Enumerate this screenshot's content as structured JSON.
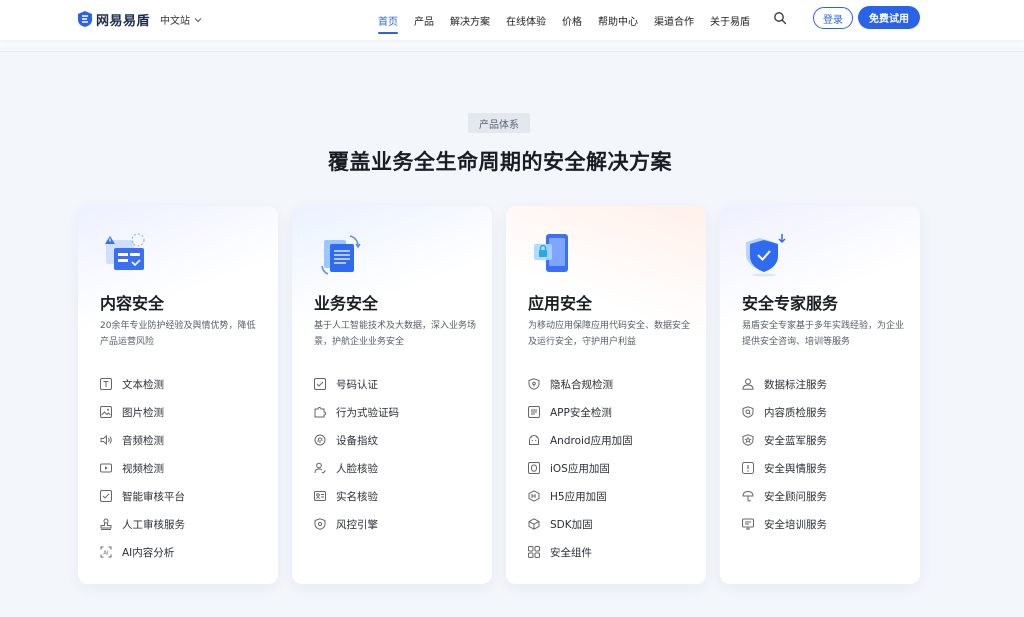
{
  "header": {
    "logo_text": "网易易盾",
    "lang_label": "中文站",
    "nav": [
      "首页",
      "产品",
      "解决方案",
      "在线体验",
      "价格",
      "帮助中心",
      "渠道合作",
      "关于易盾"
    ],
    "active_nav_index": 0,
    "login_label": "登录",
    "trial_label": "免费试用",
    "accent_color": "#2a63e8"
  },
  "section": {
    "tag": "产品体系",
    "title": "覆盖业务全生命周期的安全解决方案"
  },
  "cards": [
    {
      "title": "内容安全",
      "desc": "20余年专业防护经验及舆情优势，降低产品运营风险",
      "icon": "content-security-illustration",
      "items": [
        {
          "label": "文本检测",
          "icon": "text-icon"
        },
        {
          "label": "图片检测",
          "icon": "image-icon"
        },
        {
          "label": "音频检测",
          "icon": "audio-icon"
        },
        {
          "label": "视频检测",
          "icon": "video-icon"
        },
        {
          "label": "智能审核平台",
          "icon": "review-platform-icon"
        },
        {
          "label": "人工审核服务",
          "icon": "manual-review-icon"
        },
        {
          "label": "AI内容分析",
          "icon": "ai-analysis-icon"
        }
      ]
    },
    {
      "title": "业务安全",
      "desc": "基于人工智能技术及大数据，深入业务场景，护航企业业务安全",
      "icon": "business-security-illustration",
      "items": [
        {
          "label": "号码认证",
          "icon": "phone-verify-icon"
        },
        {
          "label": "行为式验证码",
          "icon": "puzzle-icon"
        },
        {
          "label": "设备指纹",
          "icon": "fingerprint-icon"
        },
        {
          "label": "人脸核验",
          "icon": "face-verify-icon"
        },
        {
          "label": "实名核验",
          "icon": "id-card-icon"
        },
        {
          "label": "风控引擎",
          "icon": "shield-engine-icon"
        }
      ]
    },
    {
      "title": "应用安全",
      "desc": "为移动应用保障应用代码安全、数据安全及运行安全，守护用户利益",
      "icon": "app-security-illustration",
      "items": [
        {
          "label": "隐私合规检测",
          "icon": "privacy-icon"
        },
        {
          "label": "APP安全检测",
          "icon": "app-check-icon"
        },
        {
          "label": "Android应用加固",
          "icon": "android-icon"
        },
        {
          "label": "iOS应用加固",
          "icon": "ios-icon"
        },
        {
          "label": "H5应用加固",
          "icon": "h5-icon"
        },
        {
          "label": "SDK加固",
          "icon": "sdk-icon"
        },
        {
          "label": "安全组件",
          "icon": "components-icon"
        }
      ]
    },
    {
      "title": "安全专家服务",
      "desc": "易盾安全专家基于多年实践经验，为企业提供安全咨询、培训等服务",
      "icon": "expert-service-illustration",
      "items": [
        {
          "label": "数据标注服务",
          "icon": "user-icon"
        },
        {
          "label": "内容质检服务",
          "icon": "quality-check-icon"
        },
        {
          "label": "安全蓝军服务",
          "icon": "blue-team-icon"
        },
        {
          "label": "安全舆情服务",
          "icon": "alert-icon"
        },
        {
          "label": "安全顾问服务",
          "icon": "advisor-icon"
        },
        {
          "label": "安全培训服务",
          "icon": "training-icon"
        }
      ]
    }
  ]
}
